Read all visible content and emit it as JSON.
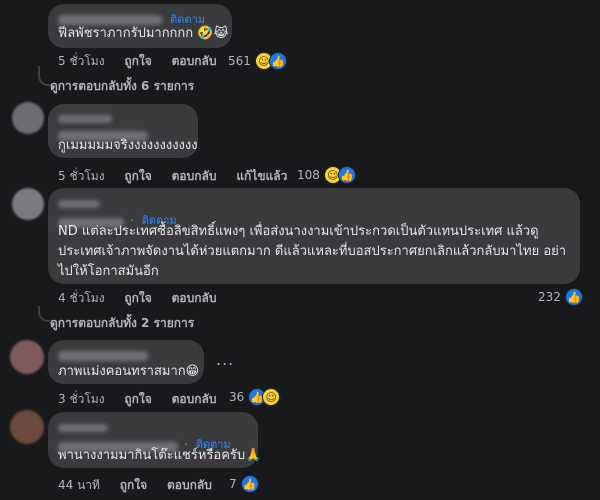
{
  "comments": [
    {
      "follow": "ติดตาม",
      "text": "ฟีลพัชราภากรัปมากกกก 🤣😹",
      "time": "5 ชั่วโมง",
      "like": "ถูกใจ",
      "reply": "ตอบกลับ",
      "reactions": "561"
    },
    {
      "text": "กูเมมมมมจริงงงงงงงงงงง",
      "time": "5 ชั่วโมง",
      "like": "ถูกใจ",
      "reply": "ตอบกลับ",
      "edited": "แก้ไขแล้ว",
      "reactions": "108"
    },
    {
      "follow": "ติดตาม",
      "text": "ND แต่ละประเทศซื้อลิขสิทธิ์แพงๆ เพื่อส่งนางงามเข้าประกวดเป็นตัวแทนประเทศ แล้วดูประเทศเจ้าภาพจัดงานได้ห่วยแตกมาก ดีแล้วแหละที่บอสประกาศยกเลิกแล้วกลับมาไทย อย่าไปให้โอกาสมันอีก",
      "time": "4 ชั่วโมง",
      "like": "ถูกใจ",
      "reply": "ตอบกลับ",
      "reactions": "232"
    },
    {
      "text": "ภาพแม่งคอนทราสมาก😁",
      "time": "3 ชั่วโมง",
      "like": "ถูกใจ",
      "reply": "ตอบกลับ",
      "reactions": "36"
    },
    {
      "follow": "ติดตาม",
      "text": "พานางงามมากินโต๊ะแชร์หรือครับ🙏",
      "time": "44 นาที",
      "like": "ถูกใจ",
      "reply": "ตอบกลับ",
      "reactions": "7"
    }
  ],
  "view_replies_1": "ดูการตอบกลับทั้ง 6 รายการ",
  "view_replies_2": "ดูการตอบกลับทั้ง 2 รายการ",
  "more_label": "...",
  "colors": {
    "accent": "#2d88ff",
    "bubble": "#3a3b3c",
    "background": "#18191a"
  }
}
